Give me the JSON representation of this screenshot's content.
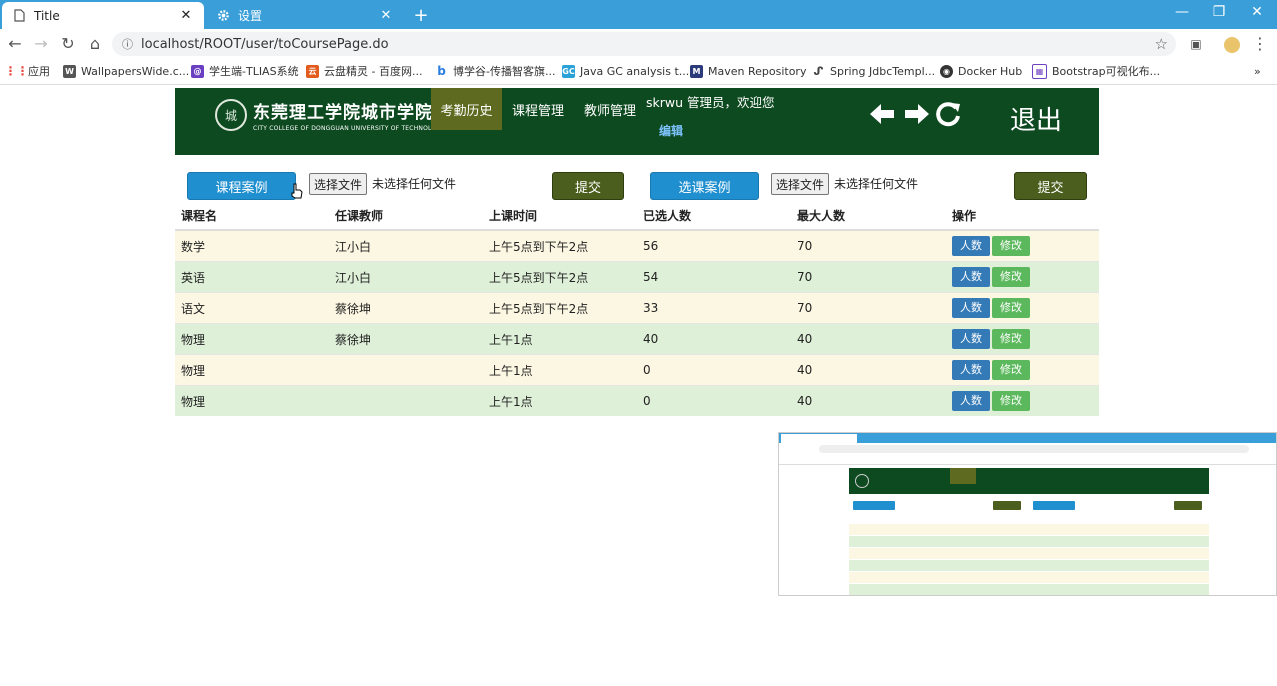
{
  "browser": {
    "tabs": [
      {
        "title": "Title",
        "active": true
      },
      {
        "title": "设置",
        "active": false
      }
    ],
    "url": "localhost/ROOT/user/toCoursePage.do",
    "bookmarks": [
      {
        "label": "应用",
        "color": "#e8453c"
      },
      {
        "label": "WallpapersWide.c...",
        "color": "#555555"
      },
      {
        "label": "学生端-TLIAS系统",
        "color": "#6a3fc1"
      },
      {
        "label": "云盘精灵 - 百度网...",
        "color": "#e25a1c"
      },
      {
        "label": "博学谷-传播智客旗...",
        "color": "#2b7de0"
      },
      {
        "label": "Java GC analysis t...",
        "color": "#2aa2d8"
      },
      {
        "label": "Maven Repository",
        "color": "#2a3a7a"
      },
      {
        "label": "Spring JdbcTempl...",
        "color": "#444444"
      },
      {
        "label": "Docker Hub",
        "color": "#333333"
      },
      {
        "label": "Bootstrap可视化布...",
        "color": "#6f42c1"
      }
    ],
    "more": "»"
  },
  "header": {
    "school_cn": "东莞理工学院城市学院",
    "school_en": "CITY COLLEGE OF DONGGUAN UNIVERSITY OF TECHNOLOGY",
    "seal_char": "城",
    "nav": [
      "考勤历史",
      "课程管理",
      "教师管理"
    ],
    "welcome": "skrwu 管理员，欢迎您",
    "edit": "编辑",
    "logout": "退出"
  },
  "upload": {
    "course_example": "课程案例",
    "select_example": "选课案例",
    "choose_file": "选择文件",
    "no_file": "未选择任何文件",
    "submit": "提交"
  },
  "table": {
    "headers": [
      "课程名",
      "任课教师",
      "上课时间",
      "已选人数",
      "最大人数",
      "操作"
    ],
    "btn_count": "人数",
    "btn_edit": "修改",
    "rows": [
      [
        "数学",
        "江小白",
        "上午5点到下午2点",
        "56",
        "70"
      ],
      [
        "英语",
        "江小白",
        "上午5点到下午2点",
        "54",
        "70"
      ],
      [
        "语文",
        "蔡徐坤",
        "上午5点到下午2点",
        "33",
        "70"
      ],
      [
        "物理",
        "蔡徐坤",
        "上午1点",
        "40",
        "40"
      ],
      [
        "物理",
        "",
        "上午1点",
        "0",
        "40"
      ],
      [
        "物理",
        "",
        "上午1点",
        "0",
        "40"
      ]
    ]
  },
  "colors": {
    "header_bg": "#0e4a20",
    "nav_active": "#5d6a1f",
    "primary_btn": "#1f8fcf",
    "submit_btn": "#4b5e1d",
    "row_odd": "#fcf7e3",
    "row_even": "#dff0d8"
  }
}
